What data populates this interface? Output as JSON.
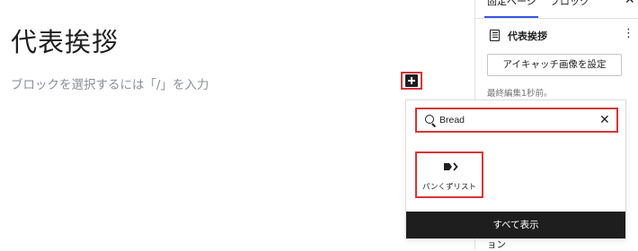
{
  "editor": {
    "title": "代表挨拶",
    "placeholder": "ブロックを選択するには「/」を入力"
  },
  "sidebar": {
    "tabs": [
      "固定ページ",
      "ブロック"
    ],
    "document_title": "代表挨拶",
    "featured_image_button": "アイキャッチ画像を設定",
    "last_edited": "最終編集1秒前。",
    "bottom_text": "ョン"
  },
  "inserter": {
    "search_value": "Bread",
    "results": [
      {
        "label": "パンくずリスト",
        "icon": "breadcrumb-icon"
      }
    ],
    "show_all_label": "すべて表示"
  },
  "colors": {
    "highlight": "#d63638",
    "accent": "#3858e9",
    "dark": "#1e1e1e"
  }
}
